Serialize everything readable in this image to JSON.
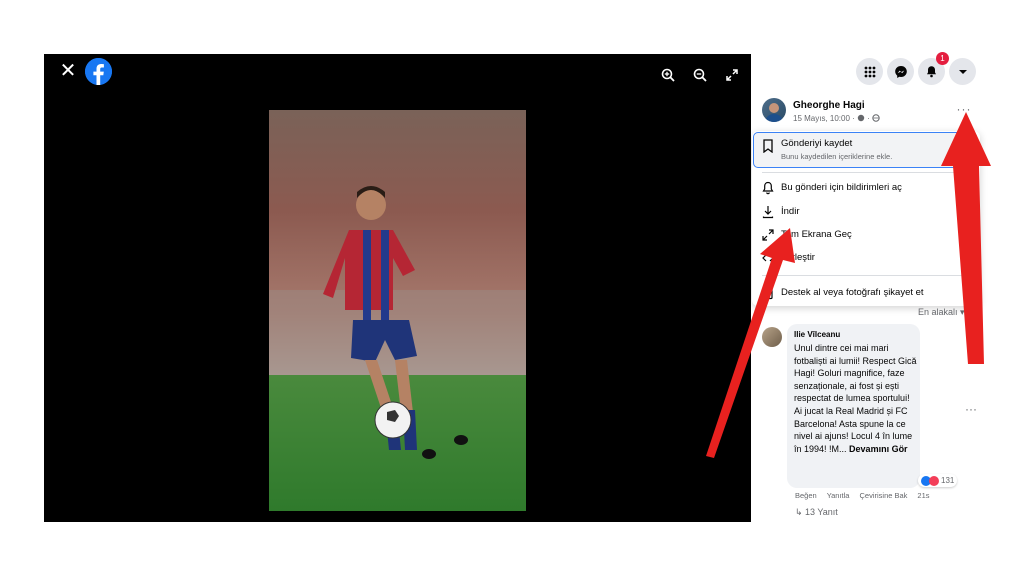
{
  "viewer": {
    "close_icon": "✕",
    "logo": "facebook-logo",
    "tools": [
      "zoom-in-icon",
      "zoom-out-icon",
      "fullscreen-icon"
    ]
  },
  "topbar": {
    "notification_count": "1"
  },
  "post": {
    "author": "Gheorghe Hagi",
    "date": "15 Mayıs, 10:00 ·",
    "more": "···"
  },
  "menu": {
    "save_label": "Gönderiyi kaydet",
    "save_sub": "Bunu kaydedilen içeriklerine ekle.",
    "items": [
      {
        "label": "Bu gönderi için bildirimleri aç",
        "icon": "bell-icon"
      },
      {
        "label": "İndir",
        "icon": "download-icon"
      },
      {
        "label": "Tam Ekrana Geç",
        "icon": "fullscreen-icon"
      },
      {
        "label": "Yerleştir",
        "icon": "embed-icon"
      }
    ],
    "report_label": "Destek al veya fotoğrafı şikayet et"
  },
  "comments": {
    "sort_label": "En alakalı ▾",
    "author": "Ilie Vîlceanu",
    "text": "Unul dintre cei mai mari fotbaliști ai lumii! Respect Gică Hagi! Goluri magnifice, faze senzaționale, ai fost și ești respectat de lumea sportului! Ai jucat la Real Madrid și FC Barcelona! Asta spune la ce nivel ai ajuns! Locul 4 în lume în 1994! !M...",
    "see_more": "Devamını Gör",
    "reaction_count": "131",
    "like": "Beğen",
    "reply": "Yanıtla",
    "translate": "Çevirisine Bak",
    "time": "21s",
    "replies": "↳ 13 Yanıt"
  },
  "colors": {
    "accent": "#1877f2",
    "arrow": "#e8211f",
    "menu_highlight": "#3b82f6"
  }
}
